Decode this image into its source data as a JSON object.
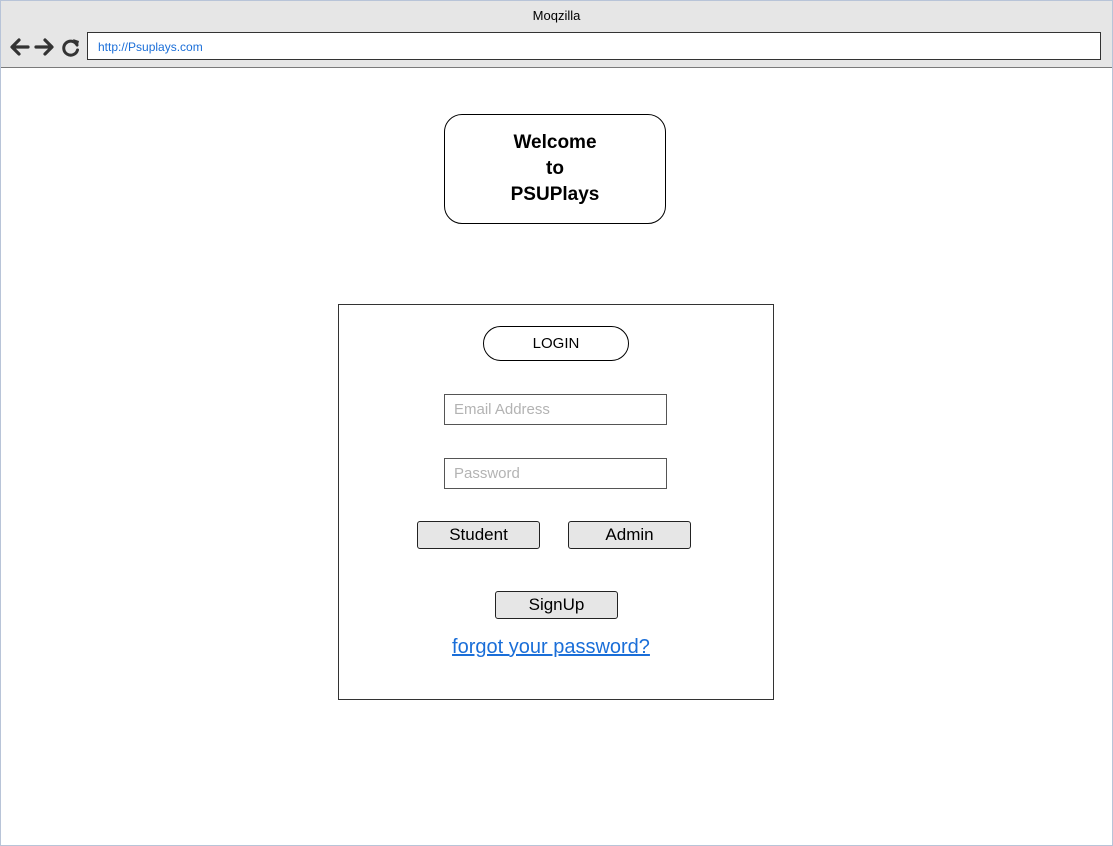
{
  "browser": {
    "title": "Moqzilla",
    "url": "http://Psuplays.com",
    "icons": [
      "back-arrow-icon",
      "forward-arrow-icon",
      "reload-icon"
    ]
  },
  "welcome": {
    "line1": "Welcome",
    "line2": "to",
    "line3": "PSUPlays"
  },
  "login": {
    "heading": "LOGIN",
    "email_placeholder": "Email Address",
    "email_value": "",
    "password_placeholder": "Password",
    "password_value": "",
    "student_label": "Student",
    "admin_label": "Admin",
    "signup_label": "SignUp",
    "forgot_label": "forgot your password?"
  },
  "colors": {
    "chrome_bg": "#e6e6e6",
    "link": "#1a6ed8",
    "button_bg": "#e6e6e6",
    "placeholder": "#b3b3b3"
  }
}
